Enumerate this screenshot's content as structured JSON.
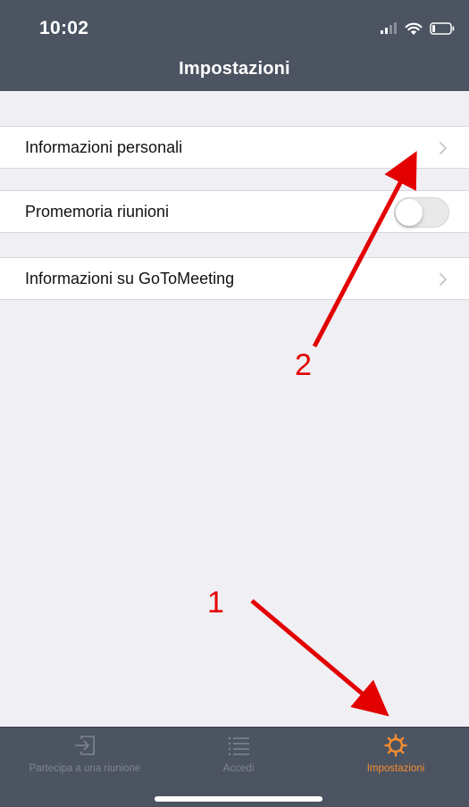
{
  "status_bar": {
    "time": "10:02"
  },
  "nav": {
    "title": "Impostazioni"
  },
  "settings": {
    "rows": [
      {
        "label": "Informazioni personali",
        "accessory": "chevron"
      },
      {
        "label": "Promemoria riunioni",
        "accessory": "toggle",
        "toggle_on": false
      },
      {
        "label": "Informazioni su GoToMeeting",
        "accessory": "chevron"
      }
    ]
  },
  "tabbar": {
    "tabs": [
      {
        "label": "Partecipa a una riunione",
        "icon": "join-meeting-icon",
        "active": false
      },
      {
        "label": "Accedi",
        "icon": "list-icon",
        "active": false
      },
      {
        "label": "Impostazioni",
        "icon": "gear-icon",
        "active": true
      }
    ]
  },
  "annotations": {
    "label_1": "1",
    "label_2": "2",
    "color": "#e30000"
  },
  "colors": {
    "bar_background": "#4c5462",
    "accent": "#f68d2e",
    "content_background": "#efeff4"
  }
}
